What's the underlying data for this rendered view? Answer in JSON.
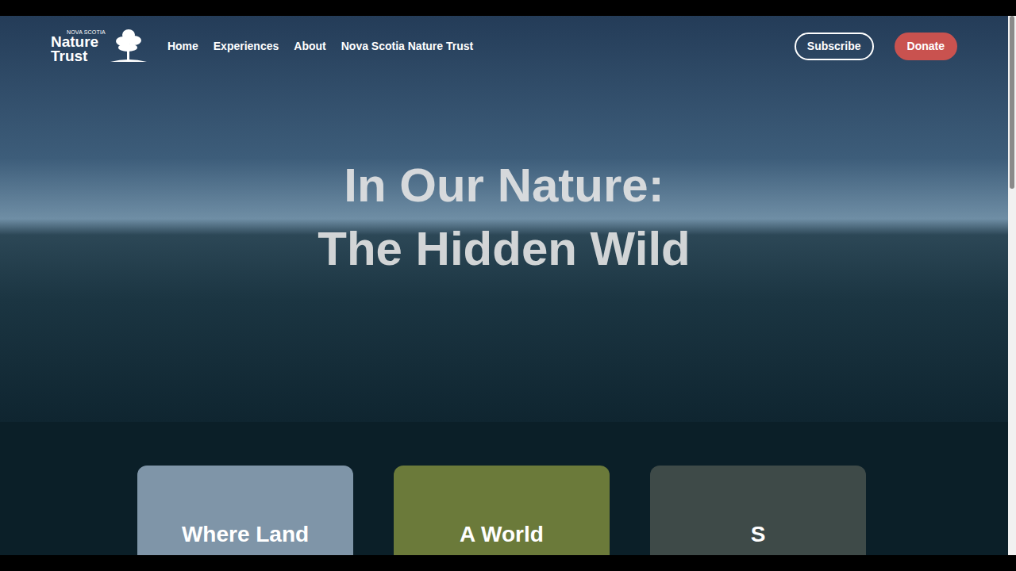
{
  "logo": {
    "top": "NOVA SCOTIA",
    "lines": [
      "Nature",
      "Trust"
    ]
  },
  "nav": [
    {
      "label": "Home"
    },
    {
      "label": "Experiences"
    },
    {
      "label": "About"
    },
    {
      "label": "Nova Scotia Nature Trust"
    }
  ],
  "actions": {
    "subscribe": "Subscribe",
    "donate": "Donate"
  },
  "hero": {
    "title_lines": [
      "In Our Nature:",
      "The Hidden Wild"
    ]
  },
  "cards": [
    {
      "title": "Where Land",
      "color": "#7f95a8"
    },
    {
      "title": "A World",
      "color": "#6b7a3a"
    },
    {
      "title": "S",
      "color": "#3e4a48"
    }
  ],
  "scrollbar": {
    "offset": 0,
    "thumb_share": 0.32
  }
}
